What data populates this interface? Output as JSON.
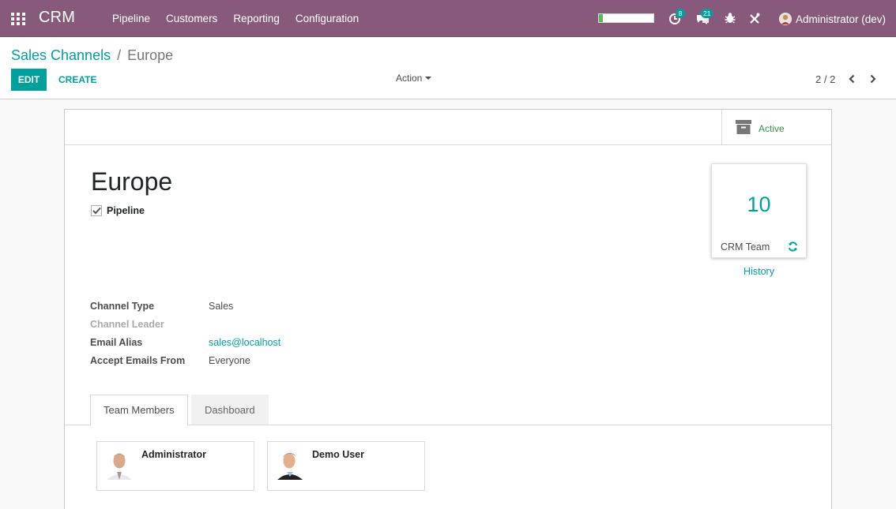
{
  "navbar": {
    "brand": "CRM",
    "menu": [
      "Pipeline",
      "Customers",
      "Reporting",
      "Configuration"
    ],
    "progress": 0.07,
    "activity_badge": "8",
    "messages_badge": "21",
    "user": "Administrator (dev)"
  },
  "control": {
    "breadcrumb_parent": "Sales Channels",
    "breadcrumb_sep": "/",
    "breadcrumb_current": "Europe",
    "edit_label": "EDIT",
    "create_label": "CREATE",
    "action_label": "Action",
    "pager": "2 / 2"
  },
  "form": {
    "active_label": "Active",
    "title": "Europe",
    "pipeline_label": "Pipeline",
    "pipeline_checked": true,
    "stat_value": "10",
    "stat_label": "CRM Team",
    "history_label": "History",
    "fields": [
      {
        "label": "Channel Type",
        "value": "Sales"
      },
      {
        "label": "Channel Leader",
        "value": ""
      },
      {
        "label": "Email Alias",
        "value": "sales@localhost"
      },
      {
        "label": "Accept Emails From",
        "value": "Everyone"
      }
    ],
    "tabs": [
      "Team Members",
      "Dashboard"
    ],
    "members": [
      "Administrator",
      "Demo User"
    ]
  },
  "colors": {
    "navbar": "#875a7b",
    "accent": "#00a09d",
    "active_green": "#3a8e47"
  },
  "icons": [
    "apps-icon",
    "activity-clock-icon",
    "messages-icon",
    "bug-icon",
    "tools-icon",
    "archive-box-icon",
    "checkmark-icon",
    "refresh-icon",
    "chevron-left-icon",
    "chevron-right-icon"
  ]
}
